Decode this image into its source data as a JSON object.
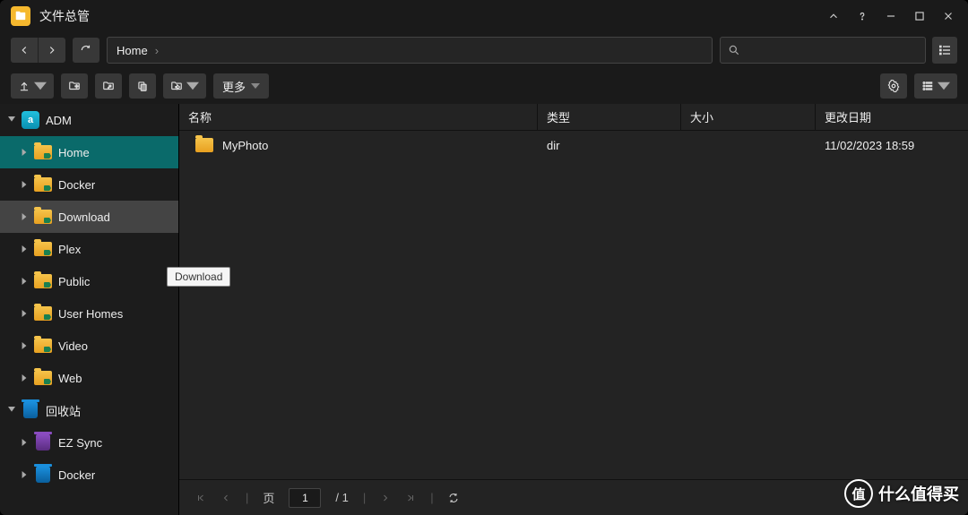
{
  "window": {
    "title": "文件总管"
  },
  "breadcrumb": {
    "path": "Home"
  },
  "toolbar": {
    "more_label": "更多"
  },
  "sidebar": {
    "adm_label": "ADM",
    "items": [
      {
        "label": "Home"
      },
      {
        "label": "Docker"
      },
      {
        "label": "Download"
      },
      {
        "label": "Plex"
      },
      {
        "label": "Public"
      },
      {
        "label": "User Homes"
      },
      {
        "label": "Video"
      },
      {
        "label": "Web"
      }
    ],
    "recycle_label": "回收站",
    "recycle_items": [
      {
        "label": "EZ Sync"
      },
      {
        "label": "Docker"
      }
    ],
    "tooltip": "Download"
  },
  "columns": {
    "name": "名称",
    "type": "类型",
    "size": "大小",
    "date": "更改日期"
  },
  "rows": [
    {
      "name": "MyPhoto",
      "type": "dir",
      "size": "",
      "date": "11/02/2023 18:59"
    }
  ],
  "pager": {
    "page_label": "页",
    "current": "1",
    "total": "/ 1"
  },
  "watermark": {
    "char": "值",
    "text": "什么值得买"
  }
}
